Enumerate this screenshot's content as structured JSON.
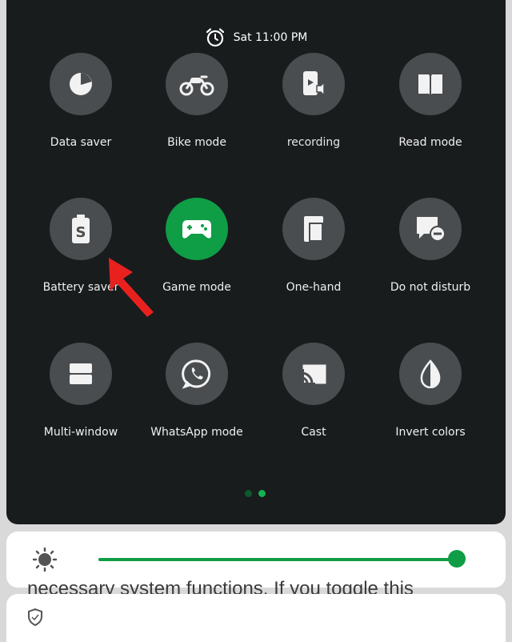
{
  "background": {
    "top_text": "",
    "bottom_text": "necessary system functions. If you toggle this"
  },
  "status": {
    "time": "Sat 11:00 PM",
    "icon": "alarm-clock-icon"
  },
  "tiles": [
    {
      "label": "Data saver",
      "icon": "pie-chart-icon",
      "active": false
    },
    {
      "label": "Bike mode",
      "icon": "motorcycle-icon",
      "active": false
    },
    {
      "label": "recording",
      "icon": "screen-recording-icon",
      "active": false
    },
    {
      "label": "Read mode",
      "icon": "book-icon",
      "active": false
    },
    {
      "label": "Battery saver",
      "icon": "battery-saver-icon",
      "active": false
    },
    {
      "label": "Game mode",
      "icon": "gamepad-icon",
      "active": true
    },
    {
      "label": "One-hand",
      "icon": "one-hand-icon",
      "active": false
    },
    {
      "label": "Do not disturb",
      "icon": "do-not-disturb-icon",
      "active": false
    },
    {
      "label": "Multi-window",
      "icon": "multi-window-icon",
      "active": false
    },
    {
      "label": "WhatsApp mode",
      "icon": "whatsapp-icon",
      "active": false
    },
    {
      "label": "Cast",
      "icon": "cast-icon",
      "active": false
    },
    {
      "label": "Invert colors",
      "icon": "invert-colors-icon",
      "active": false
    }
  ],
  "page_indicator": {
    "current": 2,
    "total": 2
  },
  "brightness": {
    "level": 0.985
  },
  "colors": {
    "panel": "#181c1d",
    "tile": "#4a4d4f",
    "accent": "#0f9d45",
    "annotation_arrow": "#e8211f",
    "dot_inactive": "#0b5a2a",
    "dot_active": "#15b351"
  }
}
